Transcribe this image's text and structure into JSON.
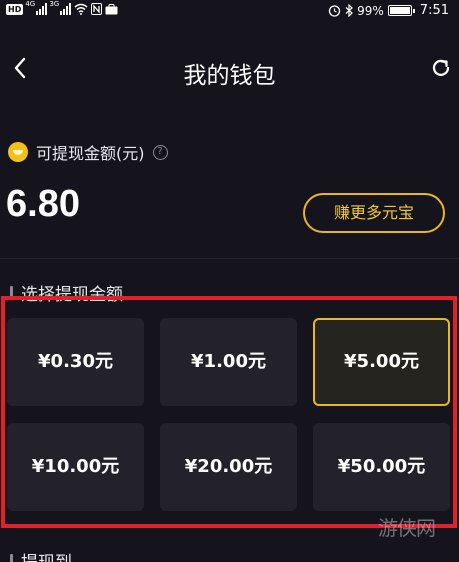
{
  "status_bar": {
    "hd": "HD",
    "sig1_label": "4G",
    "sig2_label": "3G",
    "battery_pct": "99%",
    "time": "7:51",
    "battery_level": 0.99
  },
  "header": {
    "title": "我的钱包"
  },
  "balance": {
    "label": "可提现金额(元)",
    "help_icon": "?",
    "amount": "6.80",
    "earn_button": "赚更多元宝"
  },
  "withdraw": {
    "section_title": "选择提现金额",
    "options": [
      {
        "label": "¥0.30元",
        "selected": false
      },
      {
        "label": "¥1.00元",
        "selected": false
      },
      {
        "label": "¥5.00元",
        "selected": true
      },
      {
        "label": "¥10.00元",
        "selected": false
      },
      {
        "label": "¥20.00元",
        "selected": false
      },
      {
        "label": "¥50.00元",
        "selected": false
      }
    ]
  },
  "withdraw_to": {
    "section_title": "提现到"
  },
  "watermark": "游侠网",
  "colors": {
    "background": "#15141c",
    "card": "#23222b",
    "accent_gold": "#e7b81f",
    "highlight_red": "#e0202a"
  },
  "icons": [
    "back-arrow-icon",
    "refresh-icon",
    "coin-icon",
    "help-icon",
    "wifi-icon",
    "nfc-icon",
    "briefcase-icon",
    "alarm-icon",
    "bluetooth-icon",
    "battery-icon"
  ]
}
